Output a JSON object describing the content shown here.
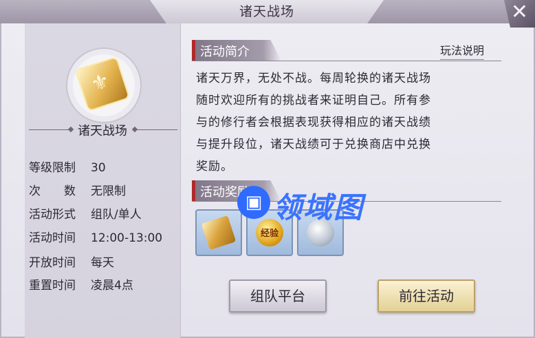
{
  "window": {
    "title": "诸天战场",
    "close_symbol": "✕"
  },
  "activity": {
    "name": "诸天战场",
    "icon": "fleur-de-lis-badge-icon",
    "info": [
      {
        "key": "等级限制",
        "value": "30"
      },
      {
        "key": "次　　数",
        "value": "无限制"
      },
      {
        "key": "活动形式",
        "value": "组队/单人"
      },
      {
        "key": "活动时间",
        "value": "12:00-13:00"
      },
      {
        "key": "开放时间",
        "value": "每天"
      },
      {
        "key": "重置时间",
        "value": "凌晨4点"
      }
    ]
  },
  "intro": {
    "heading": "活动简介",
    "help_link": "玩法说明",
    "lines": [
      "诸天万界，无处不战。每周轮换的诸天战场",
      "随时欢迎所有的挑战者来证明自己。所有参",
      "与的修行者会根据表现获得相应的诸天战绩",
      "与提升段位，诸天战绩可于兑换商店中兑换",
      "奖励。"
    ]
  },
  "rewards": {
    "heading": "活动奖励",
    "items": [
      {
        "icon": "gold-badge-icon",
        "label": ""
      },
      {
        "icon": "exp-coin-icon",
        "label": "经验"
      },
      {
        "icon": "silver-dragon-coin-icon",
        "label": ""
      }
    ]
  },
  "buttons": {
    "team": "组队平台",
    "go": "前往活动"
  },
  "watermark": {
    "text": "领域图",
    "glyph": "▣"
  }
}
